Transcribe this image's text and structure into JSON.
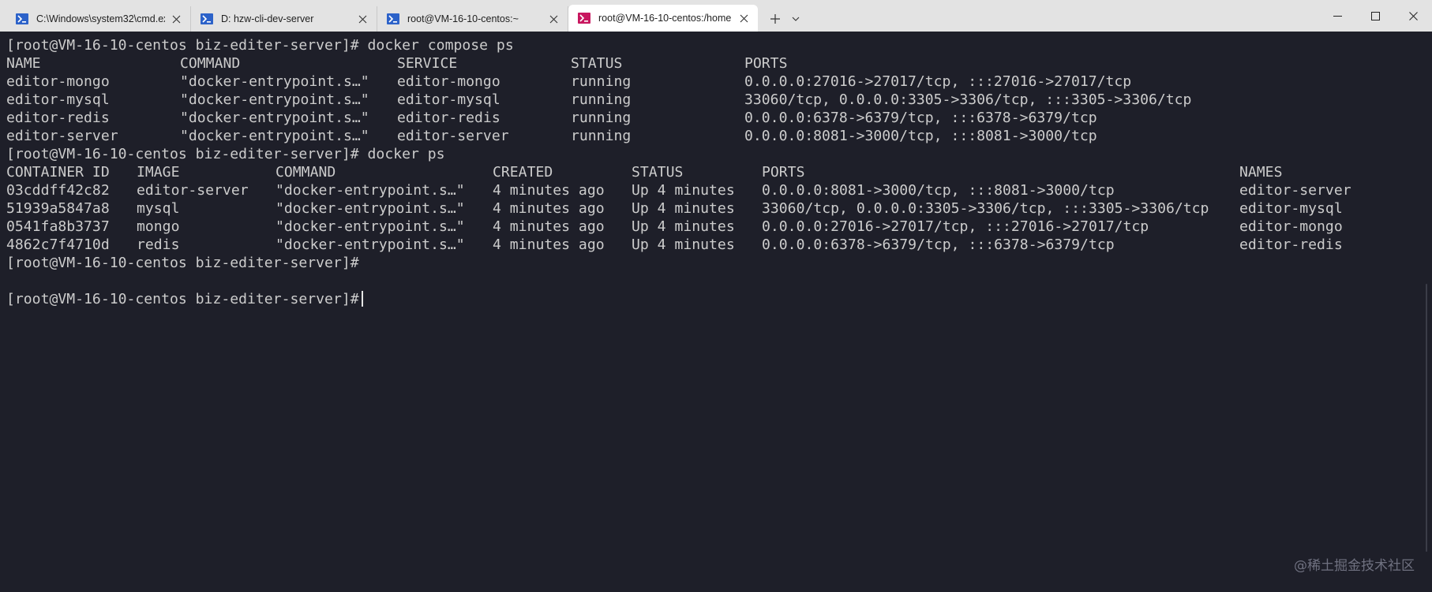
{
  "tabs": [
    {
      "label": "C:\\Windows\\system32\\cmd.exe",
      "icon": "terminal-blue-icon",
      "active": false
    },
    {
      "label": "D: hzw-cli-dev-server",
      "icon": "terminal-blue-icon",
      "active": false
    },
    {
      "label": "root@VM-16-10-centos:~",
      "icon": "terminal-blue-icon",
      "active": false
    },
    {
      "label": "root@VM-16-10-centos:/home",
      "icon": "terminal-pink-icon",
      "active": true
    }
  ],
  "colors": {
    "terminal_bg": "#1e1f29",
    "terminal_fg": "#cccccc",
    "titlebar_bg": "#e3e3e3",
    "active_tab_bg": "#ffffff",
    "icon_blue": "#2c62c9",
    "icon_pink": "#c8175f"
  },
  "terminal": {
    "prompt": "[root@VM-16-10-centos biz-editer-server]#",
    "cmd1": " docker compose ps",
    "compose_headers": [
      "NAME",
      "COMMAND",
      "SERVICE",
      "STATUS",
      "PORTS"
    ],
    "compose_rows": [
      [
        "editor-mongo",
        "\"docker-entrypoint.s…\"",
        "editor-mongo",
        "running",
        "0.0.0.0:27016->27017/tcp, :::27016->27017/tcp"
      ],
      [
        "editor-mysql",
        "\"docker-entrypoint.s…\"",
        "editor-mysql",
        "running",
        "33060/tcp, 0.0.0.0:3305->3306/tcp, :::3305->3306/tcp"
      ],
      [
        "editor-redis",
        "\"docker-entrypoint.s…\"",
        "editor-redis",
        "running",
        "0.0.0.0:6378->6379/tcp, :::6378->6379/tcp"
      ],
      [
        "editor-server",
        "\"docker-entrypoint.s…\"",
        "editor-server",
        "running",
        "0.0.0.0:8081->3000/tcp, :::8081->3000/tcp"
      ]
    ],
    "cmd2": " docker ps",
    "ps_headers": [
      "CONTAINER ID",
      "IMAGE",
      "COMMAND",
      "CREATED",
      "STATUS",
      "PORTS",
      "NAMES"
    ],
    "ps_rows": [
      [
        "03cddff42c82",
        "editor-server",
        "\"docker-entrypoint.s…\"",
        "4 minutes ago",
        "Up 4 minutes",
        "0.0.0.0:8081->3000/tcp, :::8081->3000/tcp",
        "editor-server"
      ],
      [
        "51939a5847a8",
        "mysql",
        "\"docker-entrypoint.s…\"",
        "4 minutes ago",
        "Up 4 minutes",
        "33060/tcp, 0.0.0.0:3305->3306/tcp, :::3305->3306/tcp",
        "editor-mysql"
      ],
      [
        "0541fa8b3737",
        "mongo",
        "\"docker-entrypoint.s…\"",
        "4 minutes ago",
        "Up 4 minutes",
        "0.0.0.0:27016->27017/tcp, :::27016->27017/tcp",
        "editor-mongo"
      ],
      [
        "4862c7f4710d",
        "redis",
        "\"docker-entrypoint.s…\"",
        "4 minutes ago",
        "Up 4 minutes",
        "0.0.0.0:6378->6379/tcp, :::6378->6379/tcp",
        "editor-redis"
      ]
    ]
  },
  "watermark": "@稀土掘金技术社区"
}
